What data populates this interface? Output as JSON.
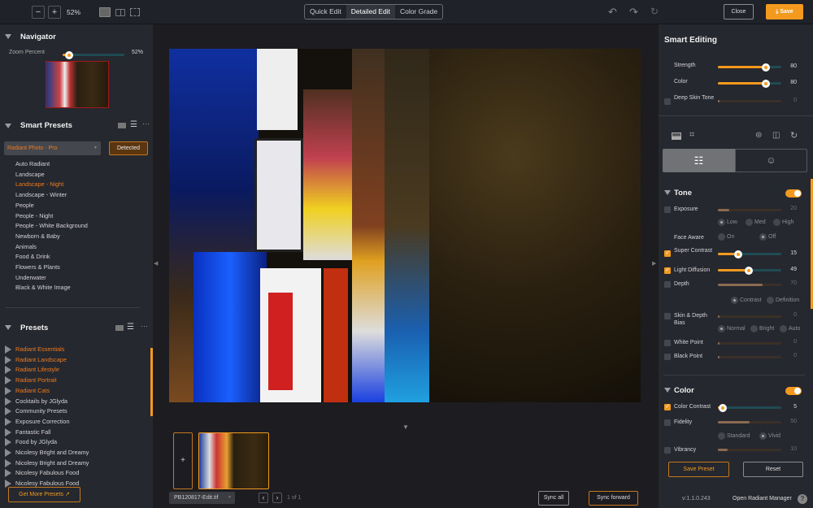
{
  "toolbar": {
    "zoom": "52%",
    "modes": [
      "Quick Edit",
      "Detailed Edit",
      "Color Grade"
    ],
    "active_mode": "Detailed Edit",
    "close": "Close",
    "save": "Save",
    "accent": "#f39a1e"
  },
  "navigator": {
    "title": "Navigator",
    "zoom_label": "Zoom Percent",
    "zoom_value": "52%",
    "zoom_percent": 52
  },
  "smart_presets": {
    "title": "Smart Presets",
    "selected": "Radiant Photo - Pro",
    "detected": "Detected",
    "items": [
      "Auto Radiant",
      "Landscape",
      "Landscape - Night",
      "Landscape - Winter",
      "People",
      "People - Night",
      "People - White Background",
      "Newborn & Baby",
      "Animals",
      "Food & Drink",
      "Flowers & Plants",
      "Underwater",
      "Black & White Image"
    ],
    "active": "Landscape - Night"
  },
  "presets": {
    "title": "Presets",
    "items": [
      {
        "label": "Radiant Essentials",
        "brand": true
      },
      {
        "label": "Radiant Landscape",
        "brand": true
      },
      {
        "label": "Radiant Lifestyle",
        "brand": true
      },
      {
        "label": "Radiant Portrait",
        "brand": true
      },
      {
        "label": "Radiant Cats",
        "brand": true
      },
      {
        "label": "Cocktails by JGlyda"
      },
      {
        "label": "Community Presets"
      },
      {
        "label": "Exposure Correction"
      },
      {
        "label": "Fantastic Fall"
      },
      {
        "label": "Food by JGlyda"
      },
      {
        "label": "Nicolesy Bright and Dreamy"
      },
      {
        "label": "Nicolesy Bright and Dreamy"
      },
      {
        "label": "Nicolesy Fabulous Food"
      },
      {
        "label": "Nicolesy Fabulous Food"
      }
    ],
    "get_more": "Get More Presets"
  },
  "filmstrip": {
    "add": "+",
    "file": "PB120817-Edit.tif",
    "page": "1 of 1",
    "sync_all": "Sync all",
    "sync_forward": "Sync forward"
  },
  "smart_editing": {
    "title": "Smart Editing",
    "strength": {
      "label": "Strength",
      "value": 80
    },
    "color": {
      "label": "Color",
      "value": 80
    },
    "deep_skin": {
      "label": "Deep Skin Tone",
      "value": 0
    }
  },
  "tone": {
    "title": "Tone",
    "exposure": {
      "label": "Exposure",
      "value": 20,
      "options": [
        "Low",
        "Med",
        "High"
      ],
      "selected": "Low"
    },
    "face_aware": {
      "label": "Face Aware",
      "options": [
        "On",
        "Off"
      ],
      "selected": "Off"
    },
    "super_contrast": {
      "label": "Super Contrast",
      "value": 15
    },
    "light_diffusion": {
      "label": "Light Diffusion",
      "value": 49
    },
    "depth": {
      "label": "Depth",
      "value": 70,
      "options": [
        "Contrast",
        "Definition"
      ],
      "selected": "Contrast"
    },
    "skin_depth": {
      "label": "Skin & Depth Bias",
      "value": 0,
      "options": [
        "Normal",
        "Bright",
        "Auto"
      ],
      "selected": "Normal"
    },
    "white_point": {
      "label": "White Point",
      "value": 0
    },
    "black_point": {
      "label": "Black Point",
      "value": 0
    }
  },
  "color": {
    "title": "Color",
    "color_contrast": {
      "label": "Color Contrast",
      "value": 5
    },
    "fidelity": {
      "label": "Fidelity",
      "value": 50,
      "options": [
        "Standard",
        "Vivid"
      ],
      "selected": "Vivid"
    },
    "vibrancy": {
      "label": "Vibrancy",
      "value": 10
    }
  },
  "footer": {
    "save_preset": "Save Preset",
    "reset": "Reset",
    "version": "v:1.1.0.243",
    "manager": "Open Radiant Manager",
    "help": "?"
  }
}
